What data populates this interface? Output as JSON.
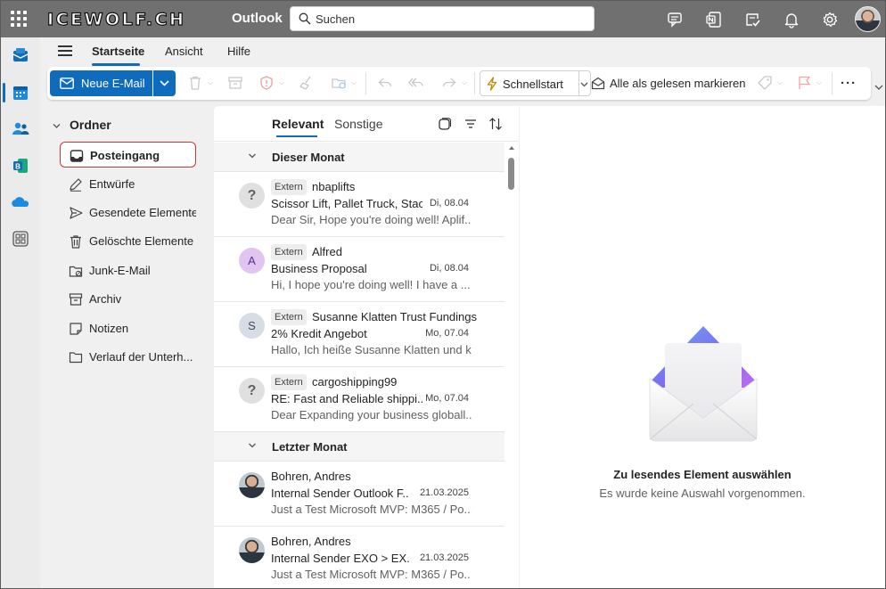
{
  "topbar": {
    "brand": "ICEWOLF.CH",
    "app_name": "Outlook",
    "search_placeholder": "Suchen",
    "icons": [
      "waffle-icon",
      "teams-chat-icon",
      "onenote-icon",
      "todo-icon",
      "bell-icon",
      "gear-icon"
    ]
  },
  "rail": {
    "items": [
      "mail-icon",
      "calendar-icon",
      "people-icon",
      "bookings-icon",
      "onedrive-icon",
      "more-apps-icon"
    ]
  },
  "ribbon": {
    "tabs": [
      "Startseite",
      "Ansicht",
      "Hilfe"
    ],
    "active_tab": "Startseite",
    "new_mail_label": "Neue E-Mail",
    "quickstart_label": "Schnellstart",
    "mark_read_label": "Alle als gelesen markieren",
    "more_label": "···"
  },
  "folders": {
    "header": "Ordner",
    "items": [
      {
        "label": "Posteingang",
        "icon": "inbox-icon",
        "selected": true
      },
      {
        "label": "Entwürfe",
        "icon": "pencil-icon"
      },
      {
        "label": "Gesendete Elemente",
        "icon": "send-icon"
      },
      {
        "label": "Gelöschte Elemente",
        "icon": "trash-icon"
      },
      {
        "label": "Junk-E-Mail",
        "icon": "junk-icon"
      },
      {
        "label": "Archiv",
        "icon": "archive-icon"
      },
      {
        "label": "Notizen",
        "icon": "note-icon"
      },
      {
        "label": "Verlauf der Unterh...",
        "icon": "folder-icon"
      }
    ]
  },
  "message_list": {
    "tabs": [
      "Relevant",
      "Sonstige"
    ],
    "active_tab": "Relevant",
    "groups": [
      {
        "label": "Dieser Monat",
        "messages": [
          {
            "avatar": "?",
            "external": "Extern",
            "sender": "nbaplifts",
            "subject": "Scissor Lift, Pallet Truck, Stac...",
            "date": "Di, 08.04",
            "preview": "Dear Sir, Hope you're doing well! Aplif..."
          },
          {
            "avatar": "A",
            "external": "Extern",
            "sender": "Alfred",
            "subject": "Business Proposal",
            "date": "Di, 08.04",
            "preview": "Hi, I hope you're doing well! I have a ..."
          },
          {
            "avatar": "S",
            "external": "Extern",
            "sender": "Susanne Klatten Trust Fundings",
            "subject": "2% Kredit Angebot",
            "date": "Mo, 07.04",
            "preview": "Hallo, Ich heiße Susanne Klatten und k..."
          },
          {
            "avatar": "?",
            "external": "Extern",
            "sender": "cargoshipping99",
            "subject": "RE: Fast and Reliable shippi...",
            "date": "Mo, 07.04",
            "preview": "Dear Expanding your business globall..."
          }
        ]
      },
      {
        "label": "Letzter Monat",
        "messages": [
          {
            "avatar": "",
            "external": "",
            "sender": "Bohren, Andres",
            "subject": "Internal Sender Outlook F...",
            "date": "21.03.2025",
            "preview": "Just a Test Microsoft MVP: M365 / Po..."
          },
          {
            "avatar": "",
            "external": "",
            "sender": "Bohren, Andres",
            "subject": "Internal Sender EXO > EX...",
            "date": "21.03.2025",
            "preview": "Just a Test Microsoft MVP: M365 / Po..."
          }
        ]
      }
    ]
  },
  "reading_pane": {
    "title": "Zu lesendes Element auswählen",
    "subtitle": "Es wurde keine Auswahl vorgenommen."
  },
  "colors": {
    "accent": "#0f6cbd",
    "topbar": "#707070",
    "selection_outline": "#d13438"
  }
}
